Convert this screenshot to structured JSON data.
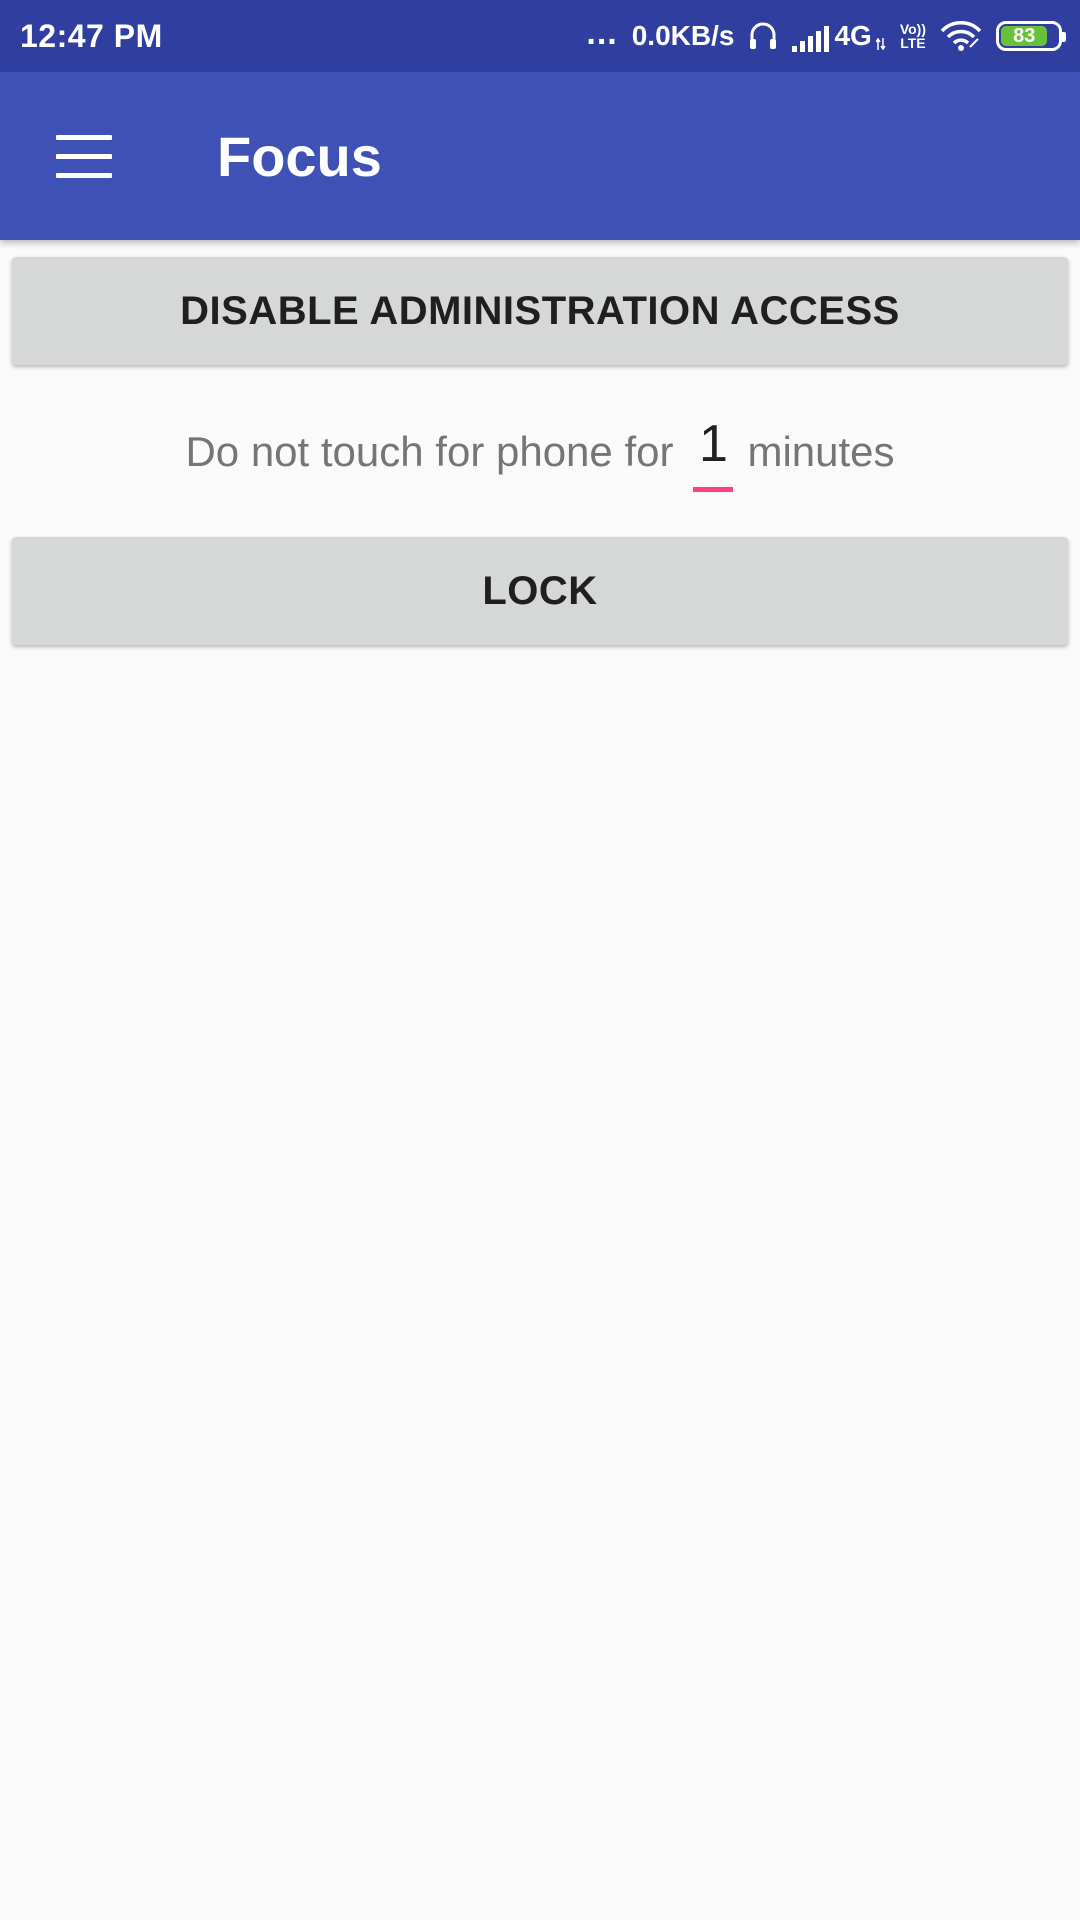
{
  "status_bar": {
    "time": "12:47 PM",
    "dots": "...",
    "speed": "0.0KB/s",
    "network_gen": "4G",
    "volte_top": "Vo))",
    "volte_bottom": "LTE",
    "battery_level": "83",
    "battery_fraction": 0.83,
    "battery_color": "#67c23a",
    "icons": [
      "headset-icon",
      "signal-icon",
      "wifi-icon",
      "battery-icon"
    ]
  },
  "app_bar": {
    "title": "Focus",
    "color": "#3f51b5",
    "menu_icon": "hamburger-menu-icon"
  },
  "main": {
    "disable_admin_label": "DISABLE ADMINISTRATION ACCESS",
    "timer_prefix": "Do not touch for phone for",
    "minutes_value": "1",
    "timer_suffix": "minutes",
    "lock_label": "LOCK",
    "accent_color": "#ff4081"
  }
}
